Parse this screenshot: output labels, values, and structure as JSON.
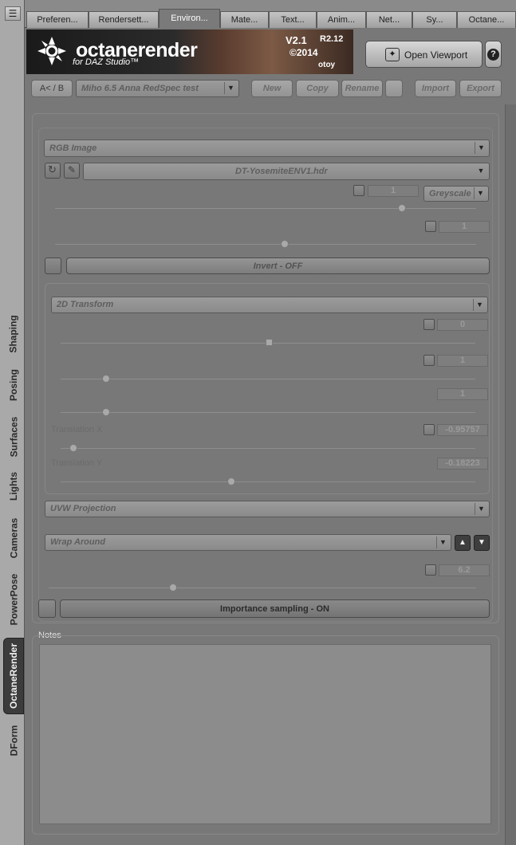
{
  "sidebar": {
    "tabs": [
      "Shaping",
      "Posing",
      "Surfaces",
      "Lights",
      "Cameras",
      "PowerPose",
      "OctaneRender",
      "DForm"
    ],
    "active": "OctaneRender"
  },
  "tabs": [
    "Preferen...",
    "Rendersett...",
    "Environ...",
    "Mate...",
    "Text...",
    "Anim...",
    "Net...",
    "Sy...",
    "Octane..."
  ],
  "active_tab": "Environ...",
  "banner": {
    "logo": "octanerender",
    "subtitle": "for DAZ Studio™",
    "version": "V2.1",
    "revision": "R2.12",
    "copyright": "©2014",
    "company": "otoy"
  },
  "toolbar": {
    "open_viewport": "Open Viewport",
    "help": "?",
    "ab_label": "A< / B",
    "preset": "Miho 6.5 Anna RedSpec test",
    "new": "New",
    "copy": "Copy",
    "rename": "Rename",
    "import": "Import",
    "export": "Export"
  },
  "texture": {
    "type": "RGB Image",
    "file": "DT-YosemiteENV1.hdr",
    "power_value": "1",
    "greyscale": "Greyscale",
    "gamma_value": "1",
    "invert": "Invert - OFF"
  },
  "transform": {
    "type": "2D Transform",
    "rotation_value": "0",
    "scale_x_value": "1",
    "scale_y_value": "1",
    "translation_x_label": "Translation X",
    "translation_x_value": "-0.95757",
    "translation_y_label": "Translation Y",
    "translation_y_value": "-0.18223"
  },
  "projection": "UVW Projection",
  "wrap": "Wrap Around",
  "power": {
    "value": "6.2"
  },
  "importance_sampling": "Importance sampling - ON",
  "notes_label": "Notes",
  "colors": {
    "panel": "#787878",
    "active_tab": "#3c3c3c"
  }
}
